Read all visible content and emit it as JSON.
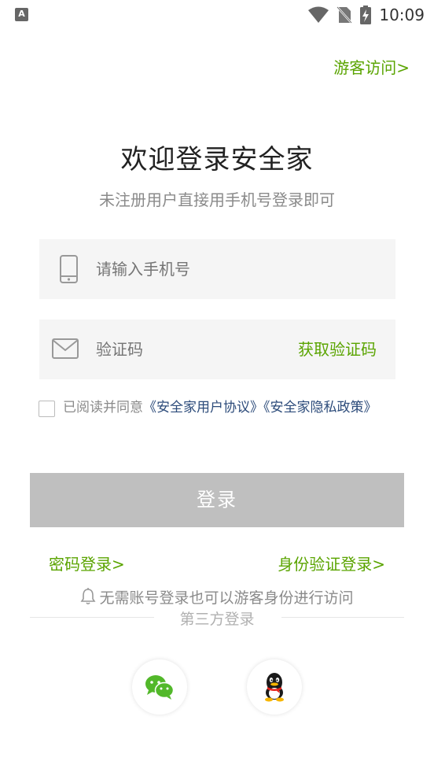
{
  "status_bar": {
    "app_badge": "A",
    "time": "10:09"
  },
  "header": {
    "guest_link": "游客访问>"
  },
  "main": {
    "title": "欢迎登录安全家",
    "subtitle": "未注册用户直接用手机号登录即可"
  },
  "form": {
    "phone_placeholder": "请输入手机号",
    "code_placeholder": "验证码",
    "get_code_label": "获取验证码"
  },
  "agreement": {
    "prefix": "已阅读并同意",
    "user_agreement": "《安全家用户协议》",
    "privacy_policy": "《安全家隐私政策》",
    "checked": false
  },
  "actions": {
    "login_label": "登录",
    "password_login": "密码登录>",
    "id_login": "身份验证登录>",
    "guest_tip": "无需账号登录也可以游客身份进行访问"
  },
  "third_party": {
    "label": "第三方登录",
    "providers": [
      "wechat-icon",
      "qq-icon"
    ]
  },
  "colors": {
    "accent": "#5aa400",
    "link": "#2c4b7a",
    "button_disabled": "#bfbfbf",
    "field_bg": "#f5f5f5"
  }
}
